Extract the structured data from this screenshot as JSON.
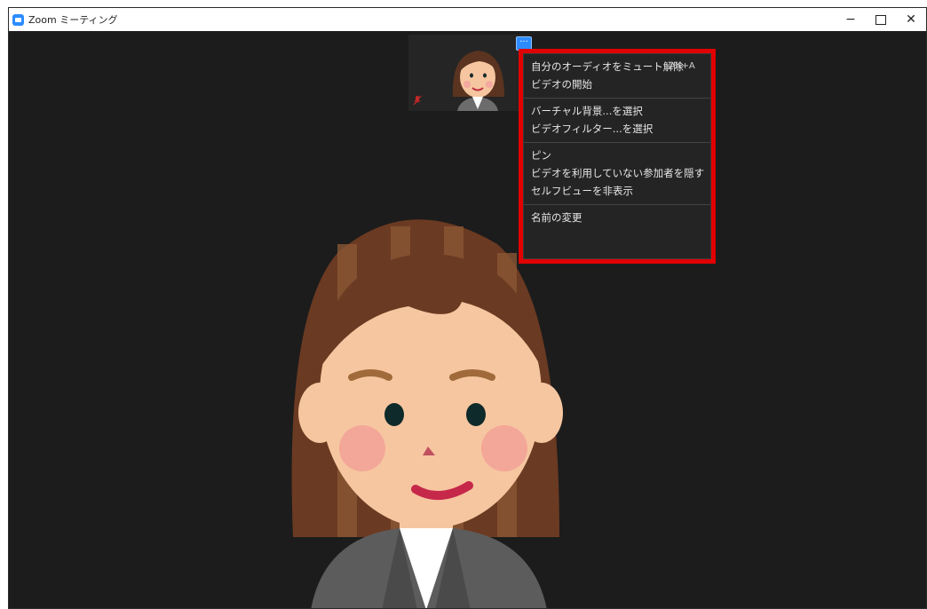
{
  "window": {
    "title": "Zoom ミーティング",
    "controls": {
      "minimize": "−",
      "close": "✕"
    }
  },
  "selfview": {
    "more_button_label": "···",
    "mic_status": "muted",
    "more_icon": "more-dots-icon"
  },
  "menu": {
    "sections": [
      {
        "items": [
          {
            "label": "自分のオーディオをミュート解除",
            "shortcut": "Alt+A"
          },
          {
            "label": "ビデオの開始"
          }
        ]
      },
      {
        "items": [
          {
            "label": "バーチャル背景...を選択"
          },
          {
            "label": "ビデオフィルター...を選択"
          }
        ]
      },
      {
        "items": [
          {
            "label": "ピン"
          },
          {
            "label": "ビデオを利用していない参加者を隠す"
          },
          {
            "label": "セルフビューを非表示"
          }
        ]
      },
      {
        "items": [
          {
            "label": "名前の変更"
          }
        ]
      }
    ]
  },
  "colors": {
    "background": "#1c1c1c",
    "accent": "#2d8cff",
    "highlight": "#e00000",
    "menu_bg": "#242424"
  }
}
